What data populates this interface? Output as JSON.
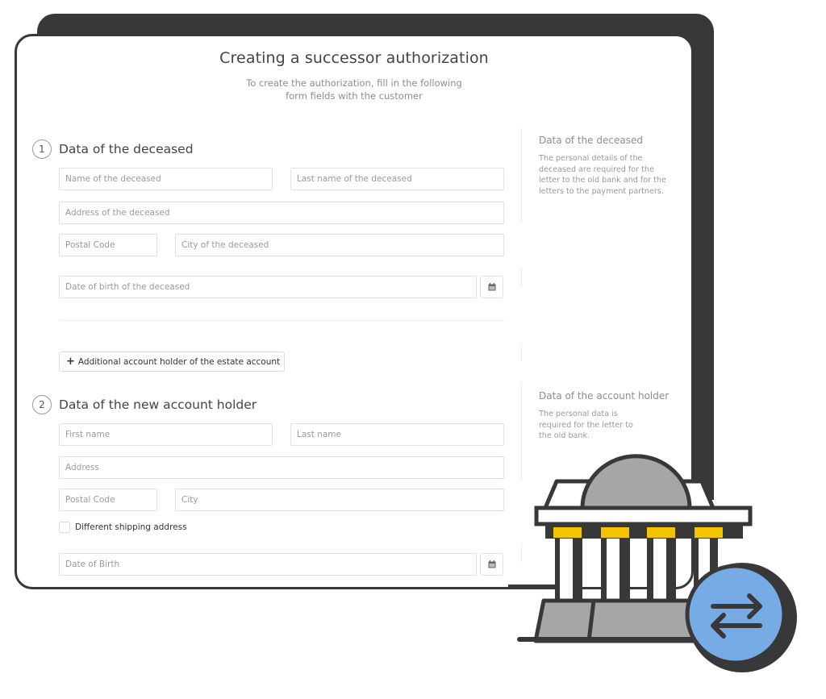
{
  "page": {
    "title": "Creating a successor authorization",
    "subtitle_line1": "To create the authorization, fill in the following",
    "subtitle_line2": "form fields with the customer"
  },
  "section1": {
    "number": "1",
    "title": "Data of the deceased",
    "fields": {
      "first_name": {
        "placeholder": "Name of the deceased",
        "value": ""
      },
      "last_name": {
        "placeholder": "Last name of the deceased",
        "value": ""
      },
      "address": {
        "placeholder": "Address of the deceased",
        "value": ""
      },
      "postal_code": {
        "placeholder": "Postal Code",
        "value": ""
      },
      "city": {
        "placeholder": "City of the deceased",
        "value": ""
      },
      "date_of_birth": {
        "placeholder": "Date of birth of the deceased",
        "value": ""
      }
    },
    "add_button_label": "Additional account holder of the estate account",
    "add_button_icon": "plus-icon",
    "calendar_icon": "calendar-icon",
    "side_heading": "Data of the deceased",
    "side_text": [
      "The personal details of the",
      "deceased are required for the",
      "letter to the old bank and for the",
      "letters to the payment partners."
    ]
  },
  "section2": {
    "number": "2",
    "title": "Data of the new account holder",
    "fields": {
      "first_name": {
        "placeholder": "First name",
        "value": ""
      },
      "last_name": {
        "placeholder": "Last name",
        "value": ""
      },
      "address": {
        "placeholder": "Address",
        "value": ""
      },
      "postal_code": {
        "placeholder": "Postal Code",
        "value": ""
      },
      "city": {
        "placeholder": "City",
        "value": ""
      },
      "date_of_birth": {
        "placeholder": "Date of Birth",
        "value": ""
      }
    },
    "shipping_checkbox_label": "Different shipping address",
    "shipping_checkbox_checked": false,
    "calendar_icon": "calendar-icon",
    "side_heading": "Data of the account holder",
    "side_text": [
      "The personal data is",
      "required for the letter to",
      "the old bank."
    ]
  },
  "illustration": {
    "name": "bank-transfer-illustration",
    "icons": [
      "bank-building-icon",
      "transfer-arrows-icon"
    ],
    "colors": {
      "outline": "#383838",
      "dome": "#a6a6a6",
      "accent": "#f5c400",
      "badge": "#77abe5"
    }
  }
}
